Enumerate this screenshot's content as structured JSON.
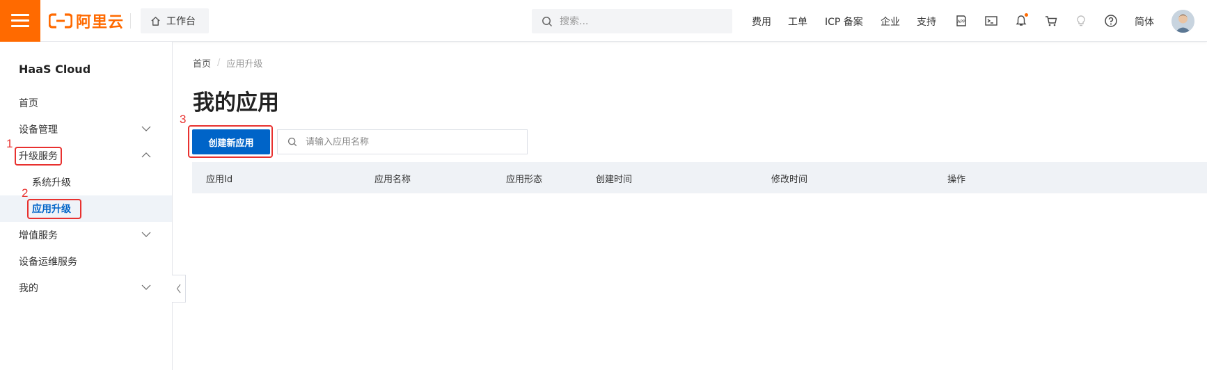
{
  "topbar": {
    "logo_text": "阿里云",
    "brand_color": "#ff6a00",
    "workbench_label": "工作台",
    "search_placeholder": "搜索...",
    "nav_links": [
      "费用",
      "工单",
      "ICP 备案",
      "企业",
      "支持"
    ],
    "icons": [
      "app-icon",
      "terminal-icon",
      "bell-icon",
      "cart-icon",
      "lightbulb-icon",
      "help-icon"
    ],
    "language": "简体"
  },
  "sidebar": {
    "product_title": "HaaS Cloud",
    "items": [
      {
        "label": "首页"
      },
      {
        "label": "设备管理"
      },
      {
        "label": "升级服务"
      },
      {
        "label": "系统升级"
      },
      {
        "label": "应用升级"
      },
      {
        "label": "增值服务"
      },
      {
        "label": "设备运维服务"
      },
      {
        "label": "我的"
      }
    ],
    "active_item": "应用升级"
  },
  "annotations": [
    "1",
    "2",
    "3"
  ],
  "main": {
    "breadcrumb": [
      "首页",
      "应用升级"
    ],
    "title": "我的应用",
    "create_button": "创建新应用",
    "search_placeholder": "请输入应用名称",
    "table_columns": [
      "应用Id",
      "应用名称",
      "应用形态",
      "创建时间",
      "修改时间",
      "操作"
    ],
    "accent_color": "#0064c8"
  }
}
